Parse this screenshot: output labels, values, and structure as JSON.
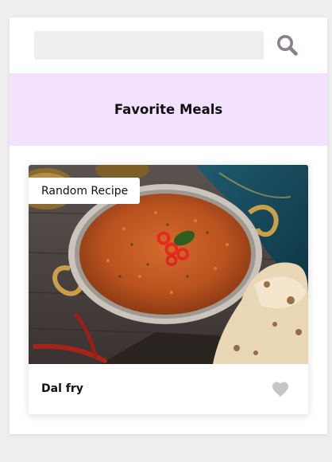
{
  "search": {
    "value": "",
    "placeholder": "",
    "icon": "search-icon",
    "icon_color": "#8c7e8a"
  },
  "header": {
    "title": "Favorite Meals",
    "background": "#f3e2ff"
  },
  "meal": {
    "tag": "Random Recipe",
    "name": "Dal fry",
    "image_alt": "Dal fry",
    "favorite_icon": "heart-icon",
    "favorite_color": "#c9c5c6"
  }
}
